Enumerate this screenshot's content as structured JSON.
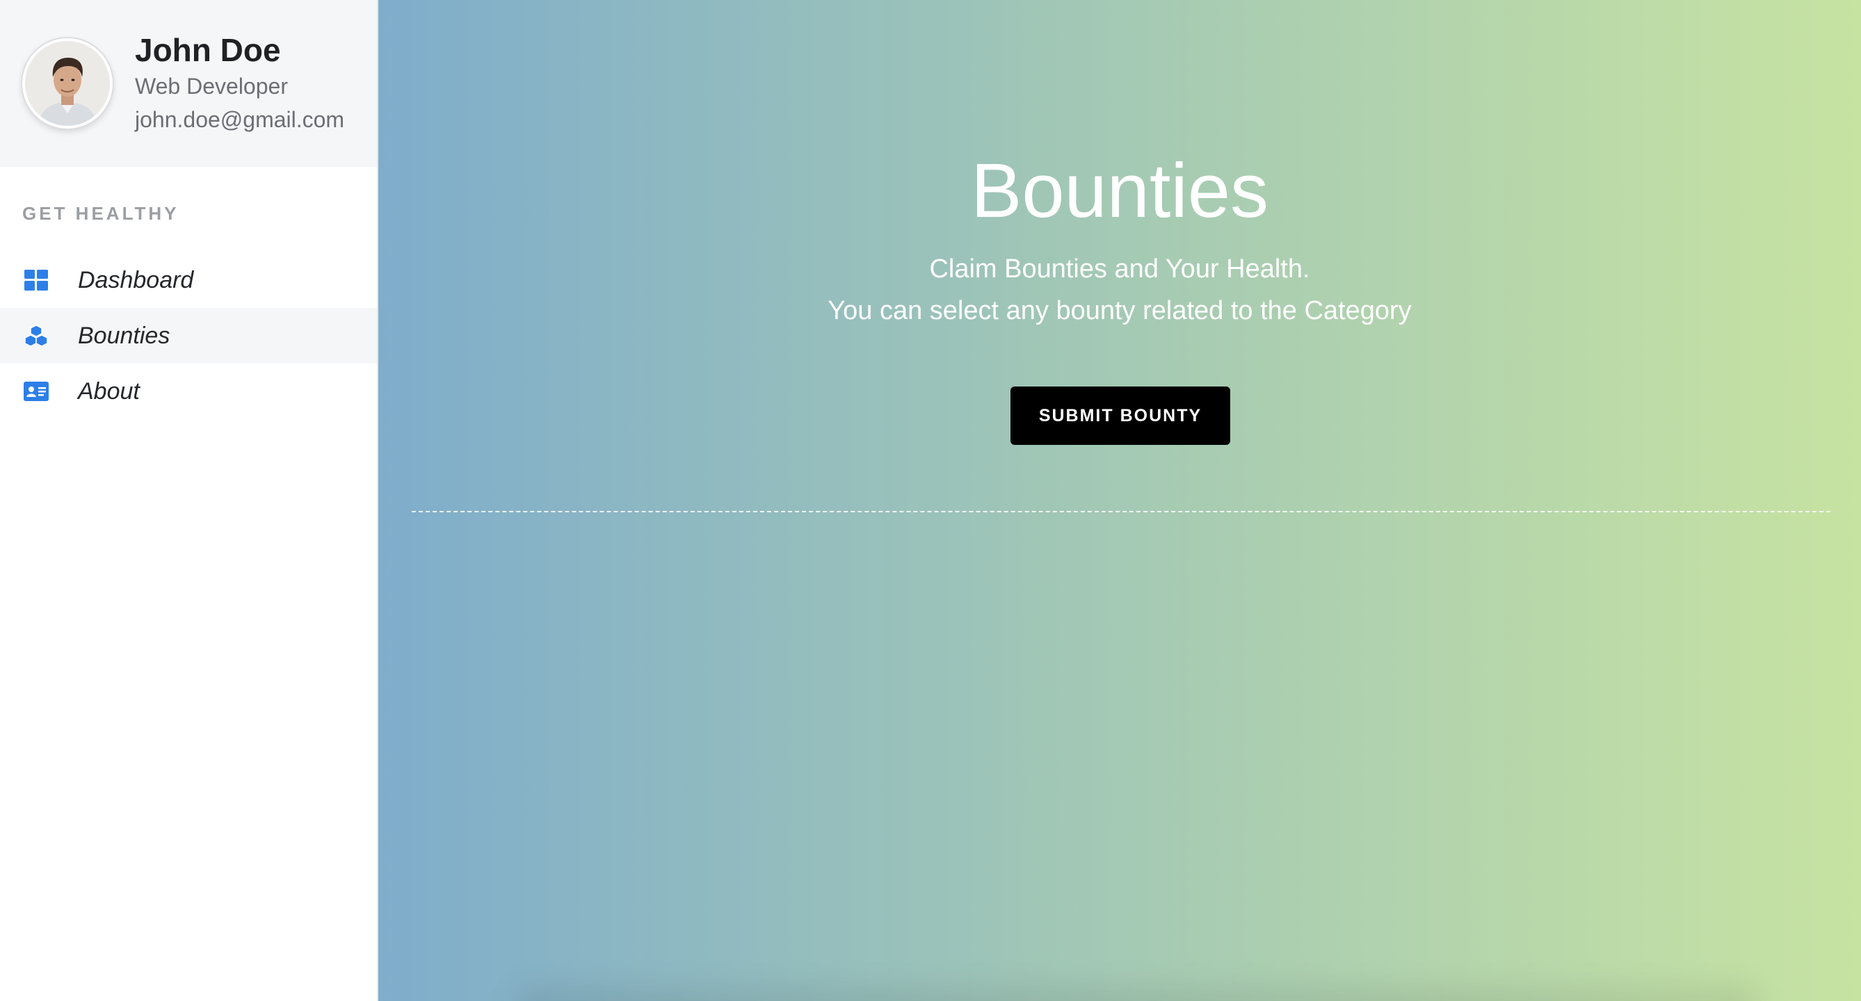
{
  "profile": {
    "name": "John Doe",
    "role": "Web Developer",
    "email": "john.doe@gmail.com"
  },
  "sidebar": {
    "section_label": "GET HEALTHY",
    "items": [
      {
        "label": "Dashboard",
        "icon": "dashboard-grid-icon",
        "active": false
      },
      {
        "label": "Bounties",
        "icon": "cubes-icon",
        "active": true
      },
      {
        "label": "About",
        "icon": "id-card-icon",
        "active": false
      }
    ],
    "icon_color": "#2d7fe8"
  },
  "main": {
    "title": "Bounties",
    "subtitle_line1": "Claim Bounties and Your Health.",
    "subtitle_line2": "You can select any bounty related to the Category",
    "submit_label": "SUBMIT BOUNTY",
    "gradient_start": "#7fadcb",
    "gradient_end": "#c7e3a2"
  }
}
